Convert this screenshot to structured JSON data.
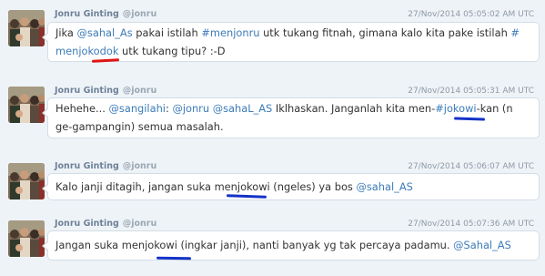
{
  "colors": {
    "background": "#eef3f7",
    "link": "#3d7bb8",
    "red_marker": "#e01414",
    "blue_marker": "#1432c8"
  },
  "tweets": [
    {
      "author_name": "Jonru Ginting",
      "author_handle": "@jonru",
      "timestamp": "27/Nov/2014 05:05:02 AM UTC",
      "lines": [
        [
          {
            "t": "Jika "
          },
          {
            "t": "@sahal_As",
            "link": true
          },
          {
            "t": " pakai istilah "
          },
          {
            "t": "#menjonru",
            "link": true
          },
          {
            "t": " utk tukang fitnah, gimana kalo kita pake istilah "
          },
          {
            "t": "#",
            "link": true
          }
        ],
        [
          {
            "t": "menjokodok",
            "link": true
          },
          {
            "t": " utk tukang tipu? :-D"
          }
        ]
      ],
      "marker_color": "red"
    },
    {
      "author_name": "Jonru Ginting",
      "author_handle": "@jonru",
      "timestamp": "27/Nov/2014 05:05:31 AM UTC",
      "lines": [
        [
          {
            "t": "Hehehe... "
          },
          {
            "t": "@sangilahi",
            "link": true
          },
          {
            "t": ": "
          },
          {
            "t": "@jonru",
            "link": true
          },
          {
            "t": " "
          },
          {
            "t": "@sahaL_AS",
            "link": true
          },
          {
            "t": " Iklhaskan. Janganlah kita men-"
          },
          {
            "t": "#jokowi",
            "link": true
          },
          {
            "t": "-kan (n"
          }
        ],
        [
          {
            "t": "ge-gampangin) semua masalah."
          }
        ]
      ],
      "marker_color": "blue"
    },
    {
      "author_name": "Jonru Ginting",
      "author_handle": "@jonru",
      "timestamp": "27/Nov/2014 05:06:07 AM UTC",
      "lines": [
        [
          {
            "t": "Kalo janji ditagih, jangan suka menjokowi (ngeles) ya bos "
          },
          {
            "t": "@sahal_AS",
            "link": true
          }
        ]
      ],
      "marker_color": "blue"
    },
    {
      "author_name": "Jonru Ginting",
      "author_handle": "@jonru",
      "timestamp": "27/Nov/2014 05:07:36 AM UTC",
      "lines": [
        [
          {
            "t": "Jangan suka menjokowi (ingkar janji), nanti banyak yg tak percaya padamu. "
          },
          {
            "t": "@Sahal_AS",
            "link": true
          }
        ]
      ],
      "marker_color": "blue"
    }
  ]
}
